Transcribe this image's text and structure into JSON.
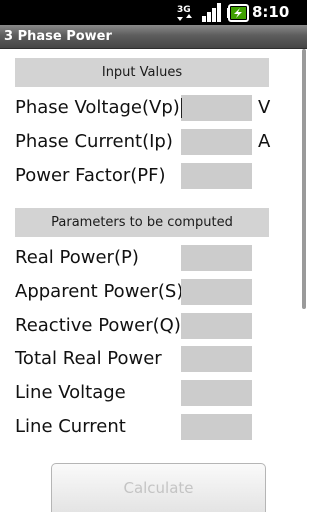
{
  "status_bar": {
    "network_type": "3G",
    "time": "8:10 AM",
    "icons": [
      "3g-icon",
      "signal-icon",
      "battery-charging-icon"
    ]
  },
  "app": {
    "title": "3 Phase Power"
  },
  "input_section": {
    "header": "Input Values",
    "rows": [
      {
        "label": "Phase Voltage(Vp)",
        "value": "",
        "unit": "V"
      },
      {
        "label": "Phase Current(Ip)",
        "value": "",
        "unit": "A"
      },
      {
        "label": "Power Factor(PF)",
        "value": "",
        "unit": ""
      }
    ]
  },
  "output_section": {
    "header": "Parameters to be computed",
    "rows": [
      {
        "label": "Real Power(P)",
        "value": ""
      },
      {
        "label": "Apparent Power(S)",
        "value": ""
      },
      {
        "label": "Reactive Power(Q)",
        "value": ""
      },
      {
        "label": "Total Real Power",
        "value": ""
      },
      {
        "label": "Line Voltage",
        "value": ""
      },
      {
        "label": "Line Current",
        "value": ""
      }
    ]
  },
  "calculate_button": {
    "label": "Calculate"
  },
  "colors": {
    "title_bar": "#5d5d5d",
    "section_header_bg": "#d3d3d3",
    "field_bg": "#cccccc",
    "background": "#ffffff"
  }
}
